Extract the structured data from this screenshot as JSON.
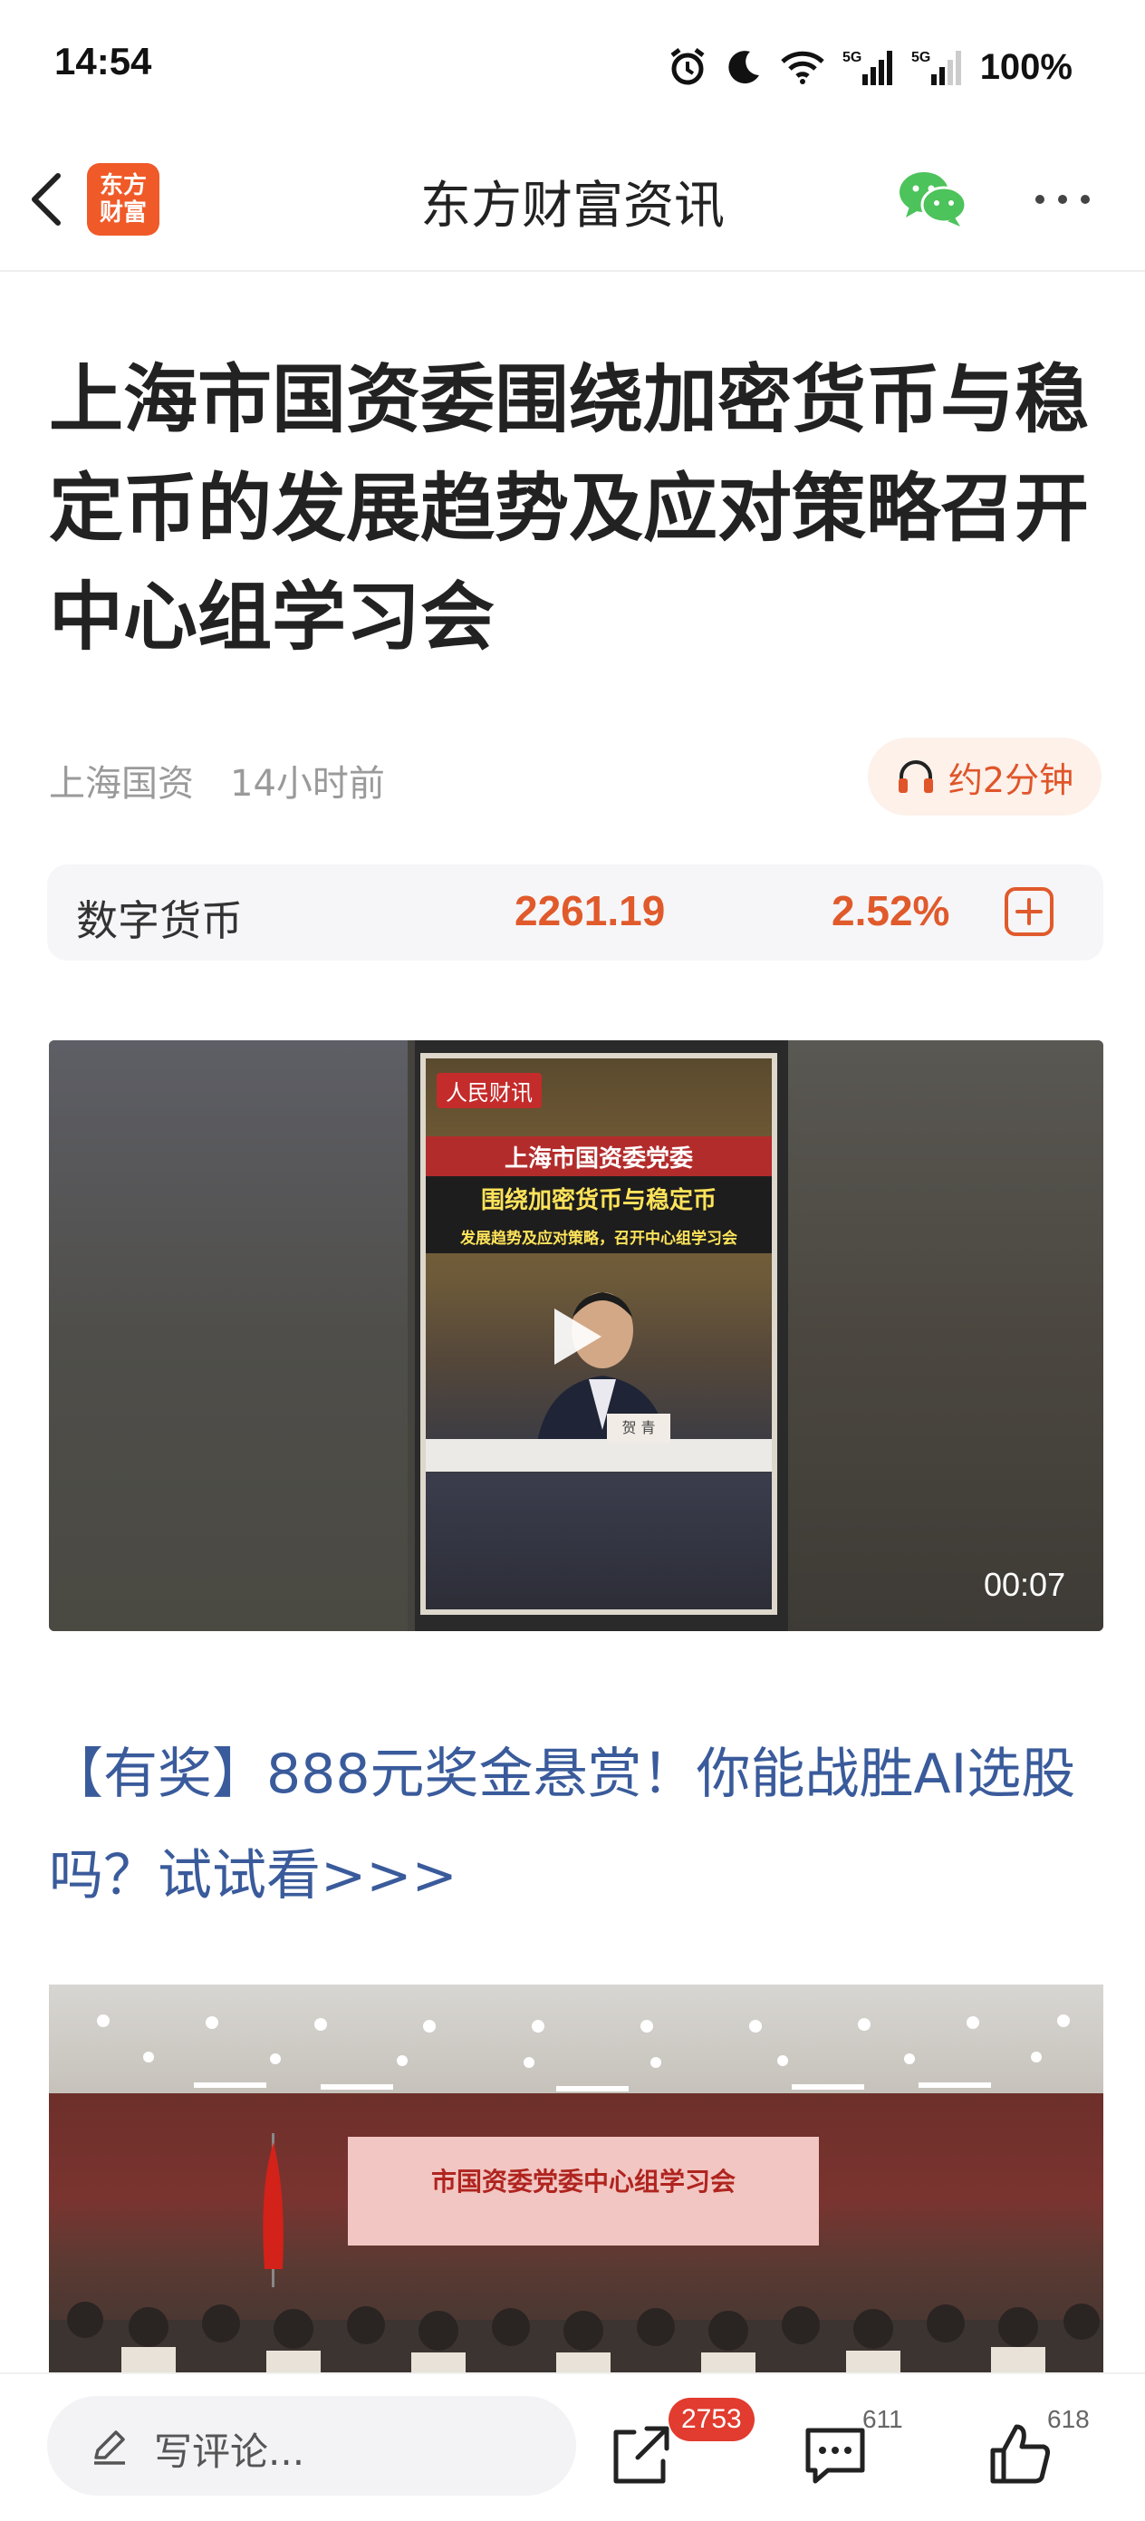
{
  "status_bar": {
    "time": "14:54",
    "battery": "100%",
    "icons": [
      "alarm-icon",
      "moon-icon",
      "wifi-icon",
      "signal-5g-icon",
      "signal-5g-icon",
      "battery-text"
    ]
  },
  "nav": {
    "logo_text": "东方\n财富",
    "title": "东方财富资讯",
    "icons": [
      "back-chevron-icon",
      "wechat-icon",
      "more-dots-icon"
    ]
  },
  "article": {
    "title": "上海市国资委围绕加密货币与稳定币的发展趋势及应对策略召开中心组学习会",
    "source": "上海国资",
    "time": "14小时前",
    "listen_label": "约2分钟"
  },
  "quote": {
    "name": "数字货币",
    "price": "2261.19",
    "change": "2.52%"
  },
  "video": {
    "duration": "00:07",
    "poster_logo": "人民财讯",
    "poster_line1": "上海市国资委党委",
    "poster_line2": "围绕加密货币与稳定币",
    "poster_line3": "发展趋势及应对策略，召开中心组学习会",
    "nameplate": "贺 青"
  },
  "promo": {
    "text": "【有奖】888元奖金悬赏！你能战胜AI选股吗？试试看>>>"
  },
  "image": {
    "banner_text": "市国资委党委中心组学习会"
  },
  "bottom_bar": {
    "comment_placeholder": "写评论...",
    "share_count": "2753",
    "comments_count": "611",
    "likes_count": "618"
  },
  "colors": {
    "accent": "#e05a2c",
    "link": "#3a5b9b",
    "badge": "#e13c2f",
    "logo": "#f05a28",
    "wechat": "#4cc35b"
  }
}
